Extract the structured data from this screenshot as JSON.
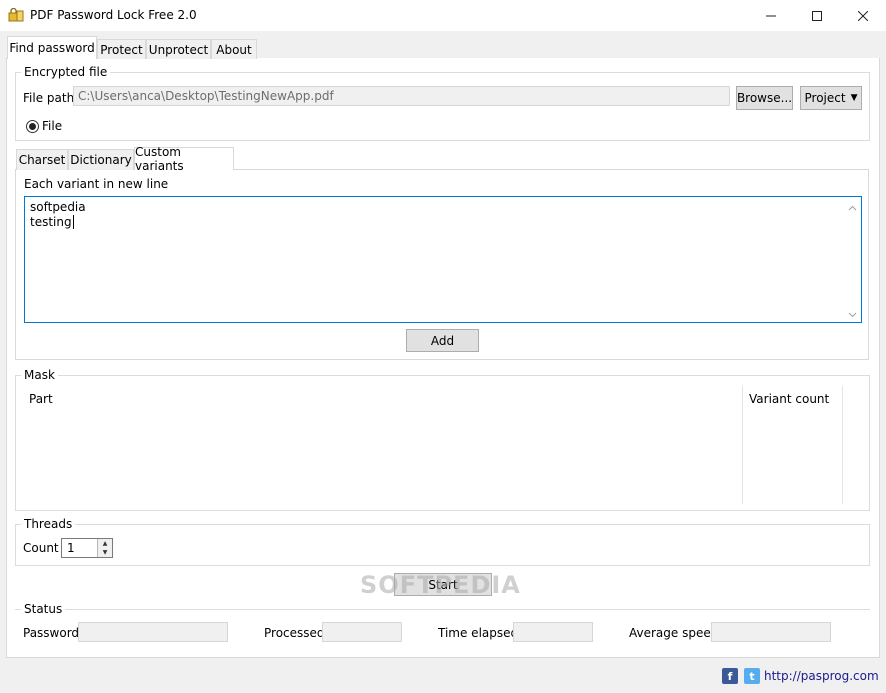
{
  "window": {
    "title": "PDF Password Lock Free 2.0",
    "minimize_icon": "minimize-icon",
    "maximize_icon": "maximize-icon",
    "close_icon": "close-icon"
  },
  "tabs": [
    {
      "label": "Find password",
      "active": true
    },
    {
      "label": "Protect"
    },
    {
      "label": "Unprotect"
    },
    {
      "label": "About"
    }
  ],
  "encrypted_file": {
    "group_title": "Encrypted file",
    "file_path_label": "File path",
    "file_path_value": "C:\\Users\\anca\\Desktop\\TestingNewApp.pdf",
    "browse_label": "Browse...",
    "project_label": "Project",
    "file_radio_label": "File"
  },
  "inner_tabs": [
    {
      "label": "Charset"
    },
    {
      "label": "Dictionary"
    },
    {
      "label": "Custom variants",
      "active": true
    }
  ],
  "custom_variants": {
    "instruction": "Each variant in new line",
    "lines": [
      "softpedia",
      "testing"
    ],
    "add_label": "Add"
  },
  "mask": {
    "group_title": "Mask",
    "columns": [
      "Part",
      "Variant count"
    ]
  },
  "threads": {
    "group_title": "Threads",
    "count_label": "Count",
    "count_value": "1"
  },
  "start_label": "Start",
  "watermark": "SOFTPEDIA",
  "status": {
    "group_title": "Status",
    "password_label": "Password",
    "processed_label": "Processed",
    "time_elapsed_label": "Time elapsed",
    "average_speed_label": "Average speed"
  },
  "footer": {
    "facebook_glyph": "f",
    "twitter_glyph": "t",
    "link_text": "http://pasprog.com"
  },
  "colors": {
    "accent_border": "#0078d7",
    "facebook": "#3b5998",
    "twitter": "#55acee"
  }
}
